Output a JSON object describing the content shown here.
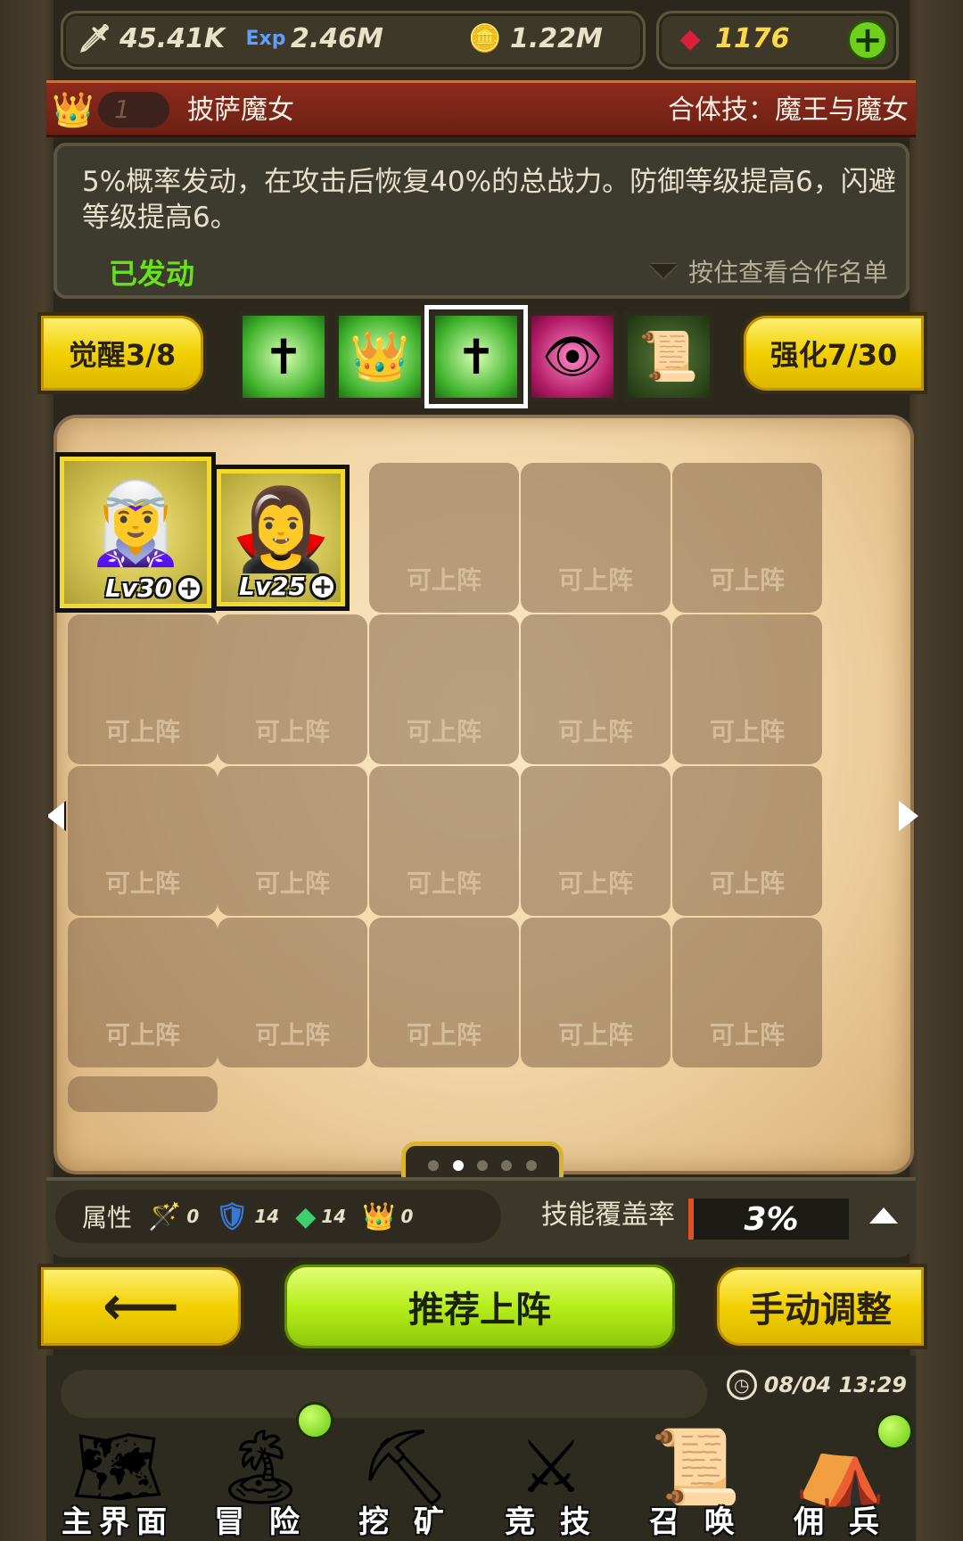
{
  "resources": {
    "attack": {
      "icon": "sword-icon",
      "value": "45.41K"
    },
    "exp": {
      "icon": "exp-icon",
      "value": "2.46M"
    },
    "gold": {
      "icon": "coin-icon",
      "value": "1.22M"
    },
    "gems": {
      "icon": "ruby-icon",
      "value": "1176"
    },
    "add_label": "+"
  },
  "skill_header": {
    "rank": "1",
    "name": "披萨魔女",
    "combo": "合体技：魔王与魔女"
  },
  "description": {
    "text": "5%概率发动，在攻击后恢复40%的总战力。防御等级提高6，闪避等级提高6。",
    "status": "已发动",
    "hold_hint": "按住查看合作名单"
  },
  "awaken_label": "觉醒3/8",
  "enhance_label": "强化7/30",
  "skill_icons": [
    {
      "name": "holy-cross-icon",
      "selected": false
    },
    {
      "name": "crown-up-icon",
      "selected": false
    },
    {
      "name": "holy-cross-handshake-icon",
      "selected": true
    },
    {
      "name": "eye-icon",
      "selected": false
    },
    {
      "name": "scroll-bundle-icon",
      "selected": false
    }
  ],
  "heroes": [
    {
      "level": "Lv30"
    },
    {
      "level": "Lv25"
    }
  ],
  "empty_slot_label": "可上阵",
  "page_indicator": {
    "count": 5,
    "current": 1
  },
  "attributes": {
    "label": "属性",
    "items": [
      {
        "icon": "staff-icon",
        "value": "0"
      },
      {
        "icon": "shield-icon",
        "value": "14"
      },
      {
        "icon": "gem-icon",
        "value": "14"
      },
      {
        "icon": "crown-icon",
        "value": "0"
      }
    ]
  },
  "coverage": {
    "label": "技能覆盖率",
    "value": "3%"
  },
  "buttons": {
    "recommend": "推荐上阵",
    "manual": "手动调整"
  },
  "clock": "08/04 13:29",
  "nav": [
    {
      "label": "主界面",
      "icon": "map-scroll-icon",
      "notify": false
    },
    {
      "label": "冒 险",
      "icon": "island-icon",
      "notify": true
    },
    {
      "label": "挖 矿",
      "icon": "pickaxe-icon",
      "notify": false
    },
    {
      "label": "竞 技",
      "icon": "crossed-swords-icon",
      "notify": false
    },
    {
      "label": "召 唤",
      "icon": "summon-scroll-icon",
      "notify": false
    },
    {
      "label": "佣 兵",
      "icon": "tent-icon",
      "notify": true
    }
  ]
}
